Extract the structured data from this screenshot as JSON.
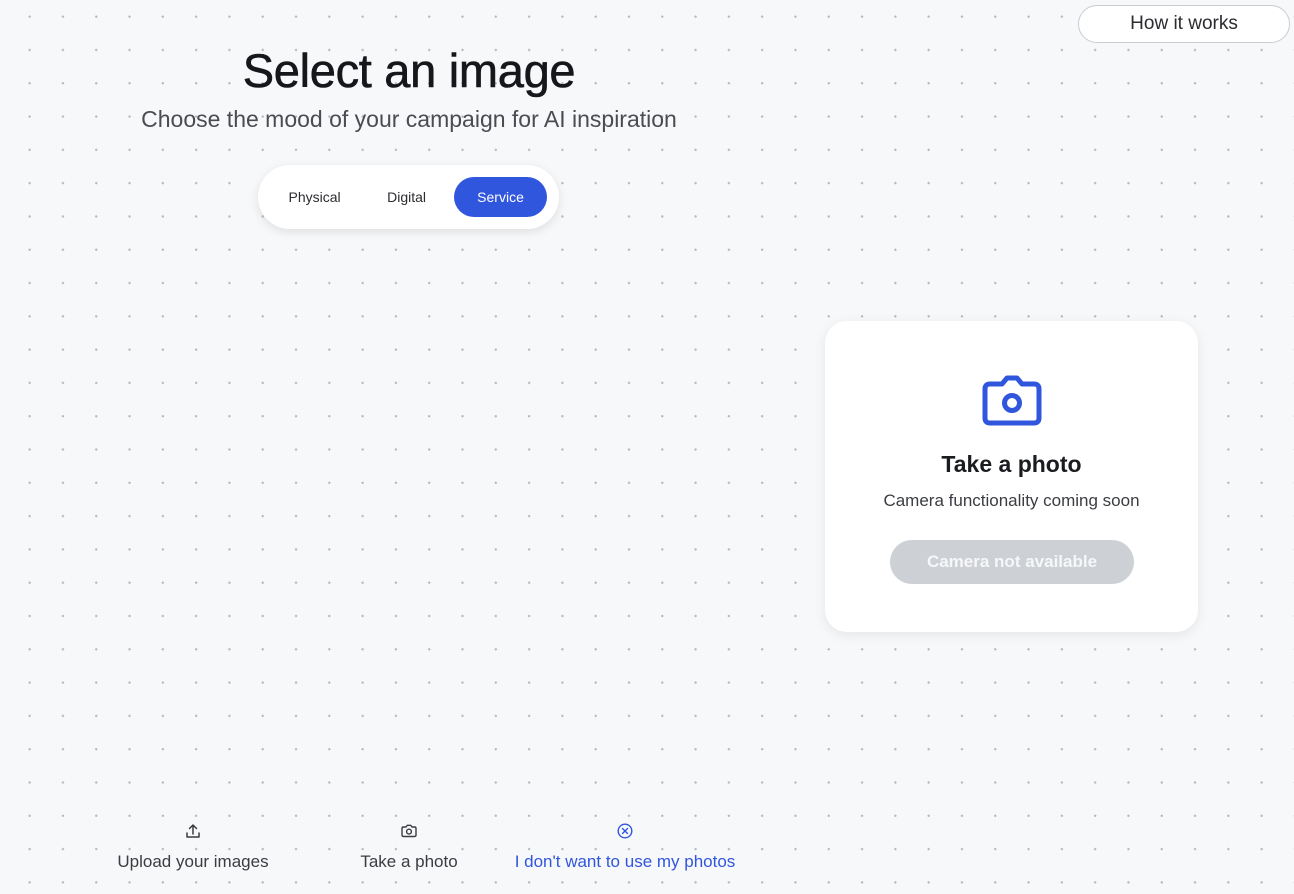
{
  "header": {
    "how_it_works_label": "How it works"
  },
  "main": {
    "title": "Select an image",
    "subtitle": "Choose the mood of your campaign for AI inspiration"
  },
  "segments": {
    "items": [
      {
        "label": "Physical",
        "active": false
      },
      {
        "label": "Digital",
        "active": false
      },
      {
        "label": "Service",
        "active": true
      }
    ]
  },
  "card": {
    "icon": "camera-icon",
    "title": "Take a photo",
    "subtitle": "Camera functionality coming soon",
    "button_label": "Camera not available",
    "button_disabled": true
  },
  "bottom_options": [
    {
      "label": "Upload your images",
      "icon": "upload-icon",
      "selected": false
    },
    {
      "label": "Take a photo",
      "icon": "camera-icon",
      "selected": false
    },
    {
      "label": "I don't want to use my photos",
      "icon": "close-circle-icon",
      "selected": true
    }
  ],
  "colors": {
    "accent": "#3156de",
    "background": "#f7f8fa",
    "disabled_button": "#cdd0d5"
  }
}
